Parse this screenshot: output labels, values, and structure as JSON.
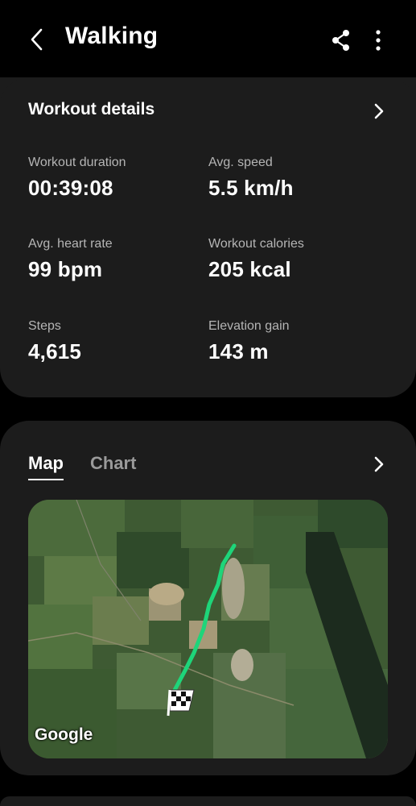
{
  "header": {
    "title": "Walking",
    "back_icon": "back-arrow-icon",
    "share_icon": "share-icon",
    "more_icon": "more-vertical-icon"
  },
  "workout_details": {
    "title": "Workout details",
    "stats": [
      {
        "label": "Workout duration",
        "value": "00:39:08"
      },
      {
        "label": "Avg. speed",
        "value": "5.5 km/h"
      },
      {
        "label": "Avg. heart rate",
        "value": "99 bpm"
      },
      {
        "label": "Workout calories",
        "value": "205 kcal"
      },
      {
        "label": "Steps",
        "value": "4,615"
      },
      {
        "label": "Elevation gain",
        "value": "143 m"
      }
    ]
  },
  "route_panel": {
    "tabs": [
      {
        "label": "Map",
        "selected": true
      },
      {
        "label": "Chart",
        "selected": false
      }
    ],
    "map_attribution": "Google",
    "route_color": "#1ed57a",
    "finish_icon": "checkered-flag-icon"
  }
}
